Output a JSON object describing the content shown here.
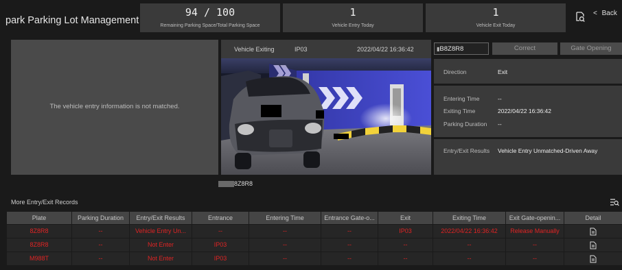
{
  "header": {
    "title": "park Parking Lot Management",
    "stats": [
      {
        "value": "94 / 100",
        "label": "Remaining Parking Space/Total Parking Space"
      },
      {
        "value": "1",
        "label": "Vehicle Entry Today"
      },
      {
        "value": "1",
        "label": "Vehicle Exit Today"
      }
    ],
    "back_label": "Back"
  },
  "entry_panel": {
    "message": "The vehicle entry information is not matched."
  },
  "camera": {
    "status": "Vehicle Exiting",
    "channel": "IP03",
    "timestamp": "2022/04/22 16:36:42",
    "plate_caption": "8Z8R8"
  },
  "controls": {
    "plate_value": "B8Z8R8",
    "correct_label": "Correct",
    "gate_label": "Gate Opening"
  },
  "info": {
    "direction_label": "Direction",
    "direction_value": "Exit",
    "entering_label": "Entering Time",
    "entering_value": "--",
    "exiting_label": "Exiting Time",
    "exiting_value": "2022/04/22 16:36:42",
    "duration_label": "Parking Duration",
    "duration_value": "--",
    "result_label": "Entry/Exit Results",
    "result_value": "Vehicle Entry Unmatched-Driven Away"
  },
  "records": {
    "title": "More Entry/Exit Records",
    "columns": [
      "Plate",
      "Parking Duration",
      "Entry/Exit Results",
      "Entrance",
      "Entering Time",
      "Entrance Gate-o...",
      "Exit",
      "Exiting Time",
      "Exit Gate-openin...",
      "Detail"
    ],
    "rows": [
      [
        "8Z8R8",
        "--",
        "Vehicle Entry Un...",
        "--",
        "--",
        "--",
        "IP03",
        "2022/04/22 16:36:42",
        "Release Manually"
      ],
      [
        "8Z8R8",
        "--",
        "Not Enter",
        "IP03",
        "--",
        "--",
        "--",
        "--",
        "--"
      ],
      [
        "M988T",
        "--",
        "Not Enter",
        "IP03",
        "--",
        "--",
        "--",
        "--",
        "--"
      ]
    ],
    "status_color": "#e02424"
  }
}
